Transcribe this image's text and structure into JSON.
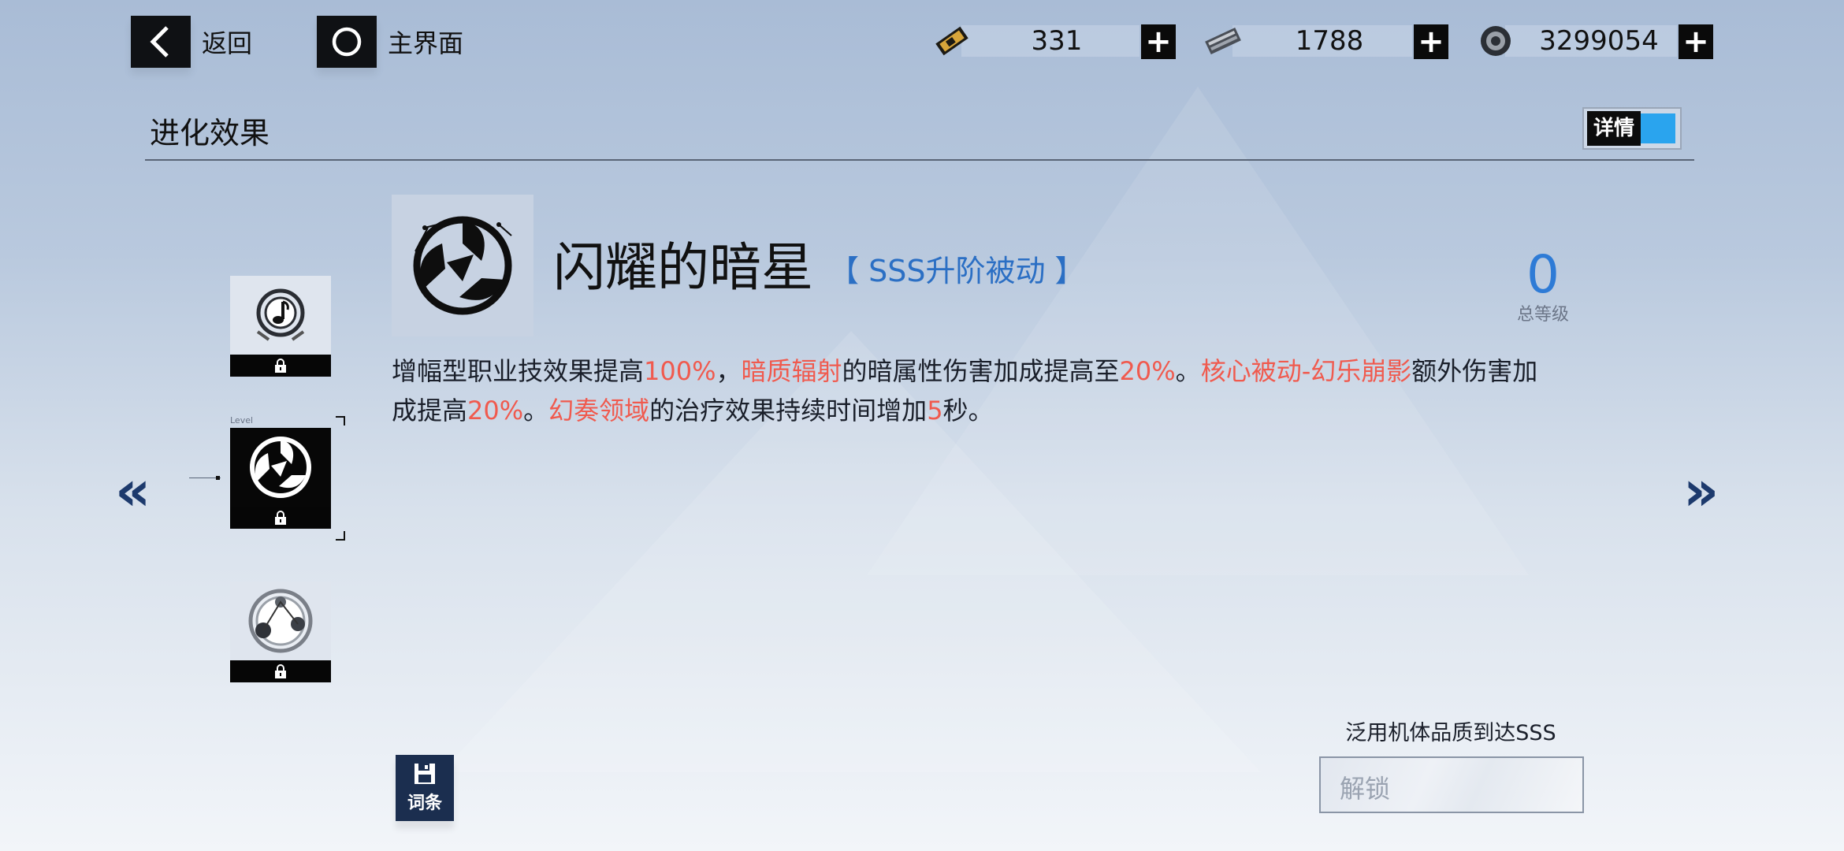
{
  "topbar": {
    "back_label": "返回",
    "home_label": "主界面",
    "resources": [
      {
        "icon": "gold-ticket-icon",
        "value": "331"
      },
      {
        "icon": "metal-plate-icon",
        "value": "1788"
      },
      {
        "icon": "gear-coin-icon",
        "value": "3299054"
      }
    ],
    "plus_label": "+"
  },
  "header": {
    "title": "进化效果",
    "detail_label": "详情",
    "detail_toggle_color": "#2aa4ee"
  },
  "list": {
    "level_tag": "Level",
    "items": [
      {
        "icon": "music-note-emblem-icon",
        "locked": true
      },
      {
        "icon": "dark-star-emblem-icon",
        "locked": true,
        "selected": true
      },
      {
        "icon": "orbit-nodes-emblem-icon",
        "locked": true
      }
    ]
  },
  "nav": {
    "prev": "«",
    "next": "»"
  },
  "skill": {
    "name": "闪耀的暗星",
    "type": "【 SSS升阶被动 】",
    "level_value": "0",
    "level_label": "总等级",
    "desc": [
      {
        "t": "增幅型职业技效果提高",
        "h": false
      },
      {
        "t": "100%",
        "h": true
      },
      {
        "t": "，",
        "h": false
      },
      {
        "t": "暗质辐射",
        "h": true
      },
      {
        "t": "的暗属性伤害加成提高至",
        "h": false
      },
      {
        "t": "20%",
        "h": true
      },
      {
        "t": "。",
        "h": false
      },
      {
        "t": "核心被动-幻乐崩影",
        "h": true
      },
      {
        "t": "额外伤害加成提高",
        "h": false
      },
      {
        "t": "20%",
        "h": true
      },
      {
        "t": "。",
        "h": false
      },
      {
        "t": "幻奏领域",
        "h": true
      },
      {
        "t": "的治疗效果持续时间增加",
        "h": false
      },
      {
        "t": "5",
        "h": true
      },
      {
        "t": "秒。",
        "h": false
      }
    ],
    "highlight_color": "#f05a4e"
  },
  "footer": {
    "word_label": "词条",
    "requirement": "泛用机体品质到达SSS",
    "unlock_label": "解锁"
  }
}
